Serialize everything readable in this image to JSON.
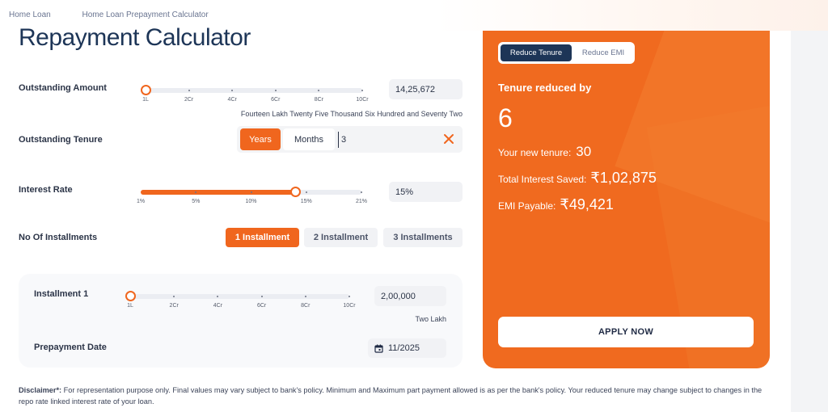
{
  "breadcrumb": {
    "home": "Home Loan",
    "current": "Home Loan Prepayment Calculator"
  },
  "page_title": "Repayment Calculator",
  "outstanding_amount": {
    "label": "Outstanding Amount",
    "value": "14,25,672",
    "words": "Fourteen Lakh Twenty Five Thousand Six Hundred and Seventy Two",
    "ticks": [
      "1L",
      "2Cr",
      "4Cr",
      "6Cr",
      "8Cr",
      "10Cr"
    ],
    "slider_fraction": 0.0
  },
  "outstanding_tenure": {
    "label": "Outstanding Tenure",
    "years_label": "Years",
    "months_label": "Months",
    "input_value": "3"
  },
  "interest_rate": {
    "label": "Interest Rate",
    "value": "15%",
    "ticks": [
      "1%",
      "5%",
      "10%",
      "15%",
      "21%"
    ],
    "slider_fraction": 0.7
  },
  "installments": {
    "label": "No Of Installments",
    "options": [
      "1 Installment",
      "2 Installment",
      "3 Installments"
    ],
    "selected": "1 Installment"
  },
  "installment_1": {
    "label": "Installment 1",
    "value": "2,00,000",
    "words": "Two Lakh",
    "ticks": [
      "1L",
      "2Cr",
      "4Cr",
      "6Cr",
      "8Cr",
      "10Cr"
    ],
    "slider_fraction": 0.0,
    "date_label": "Prepayment Date",
    "date_value": "11/2025"
  },
  "disclaimer": {
    "prefix": "Disclaimer*:",
    "text": " For representation purpose only. Final values may vary subject to bank's policy. Minimum and Maximum part payment allowed is as per the bank's policy. Your reduced tenure may change subject to changes in the repo rate linked interest rate of your loan."
  },
  "result_panel": {
    "toggle_active": "Reduce Tenure",
    "toggle_inactive": "Reduce EMI",
    "heading": "Tenure reduced by",
    "big_value": "6",
    "new_tenure_label": "Your new tenure:",
    "new_tenure_value": "30",
    "interest_saved_label": "Total Interest Saved:",
    "interest_saved_value": "₹1,02,875",
    "emi_label": "EMI Payable:",
    "emi_value": "₹49,421",
    "apply_label": "APPLY NOW"
  },
  "colors": {
    "accent": "#f0661e",
    "navy": "#1d3557"
  }
}
